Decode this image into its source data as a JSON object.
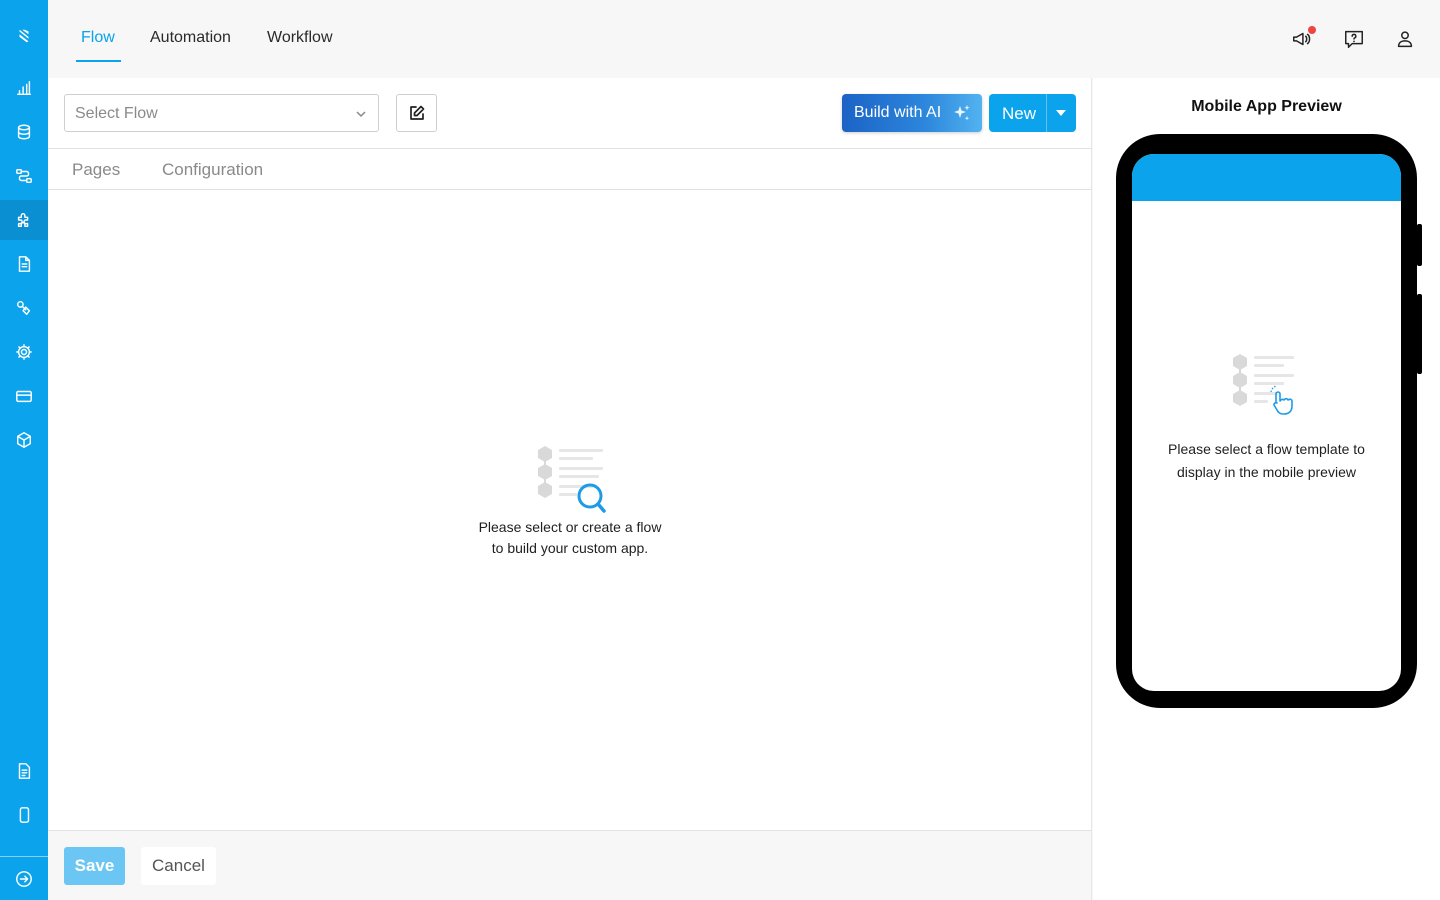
{
  "sidebar": {
    "items": [
      {
        "icon": "logo-icon"
      },
      {
        "icon": "analytics-icon"
      },
      {
        "icon": "database-icon"
      },
      {
        "icon": "flow-icon"
      },
      {
        "icon": "plugin-icon",
        "active": true
      },
      {
        "icon": "document-icon"
      },
      {
        "icon": "integrations-icon"
      },
      {
        "icon": "settings-icon"
      },
      {
        "icon": "billing-icon"
      },
      {
        "icon": "package-icon"
      }
    ],
    "bottom_items": [
      {
        "icon": "notes-icon"
      },
      {
        "icon": "mobile-icon"
      },
      {
        "icon": "expand-icon"
      }
    ],
    "accent": "#0aa3ec"
  },
  "topnav": {
    "tabs": [
      {
        "label": "Flow",
        "active": true
      },
      {
        "label": "Automation",
        "active": false
      },
      {
        "label": "Workflow",
        "active": false
      }
    ],
    "icons": [
      "announcement-icon",
      "help-icon",
      "user-icon"
    ]
  },
  "toolbar": {
    "select_placeholder": "Select Flow",
    "build_ai_label": "Build with AI",
    "new_label": "New"
  },
  "subtabs": [
    {
      "label": "Pages"
    },
    {
      "label": "Configuration"
    }
  ],
  "main": {
    "empty_line1": "Please select or create a flow",
    "empty_line2": "to build your custom app."
  },
  "footer": {
    "save_label": "Save",
    "cancel_label": "Cancel"
  },
  "preview": {
    "title": "Mobile App Preview",
    "empty_line1": "Please select a flow template to",
    "empty_line2": "display in the mobile preview"
  }
}
